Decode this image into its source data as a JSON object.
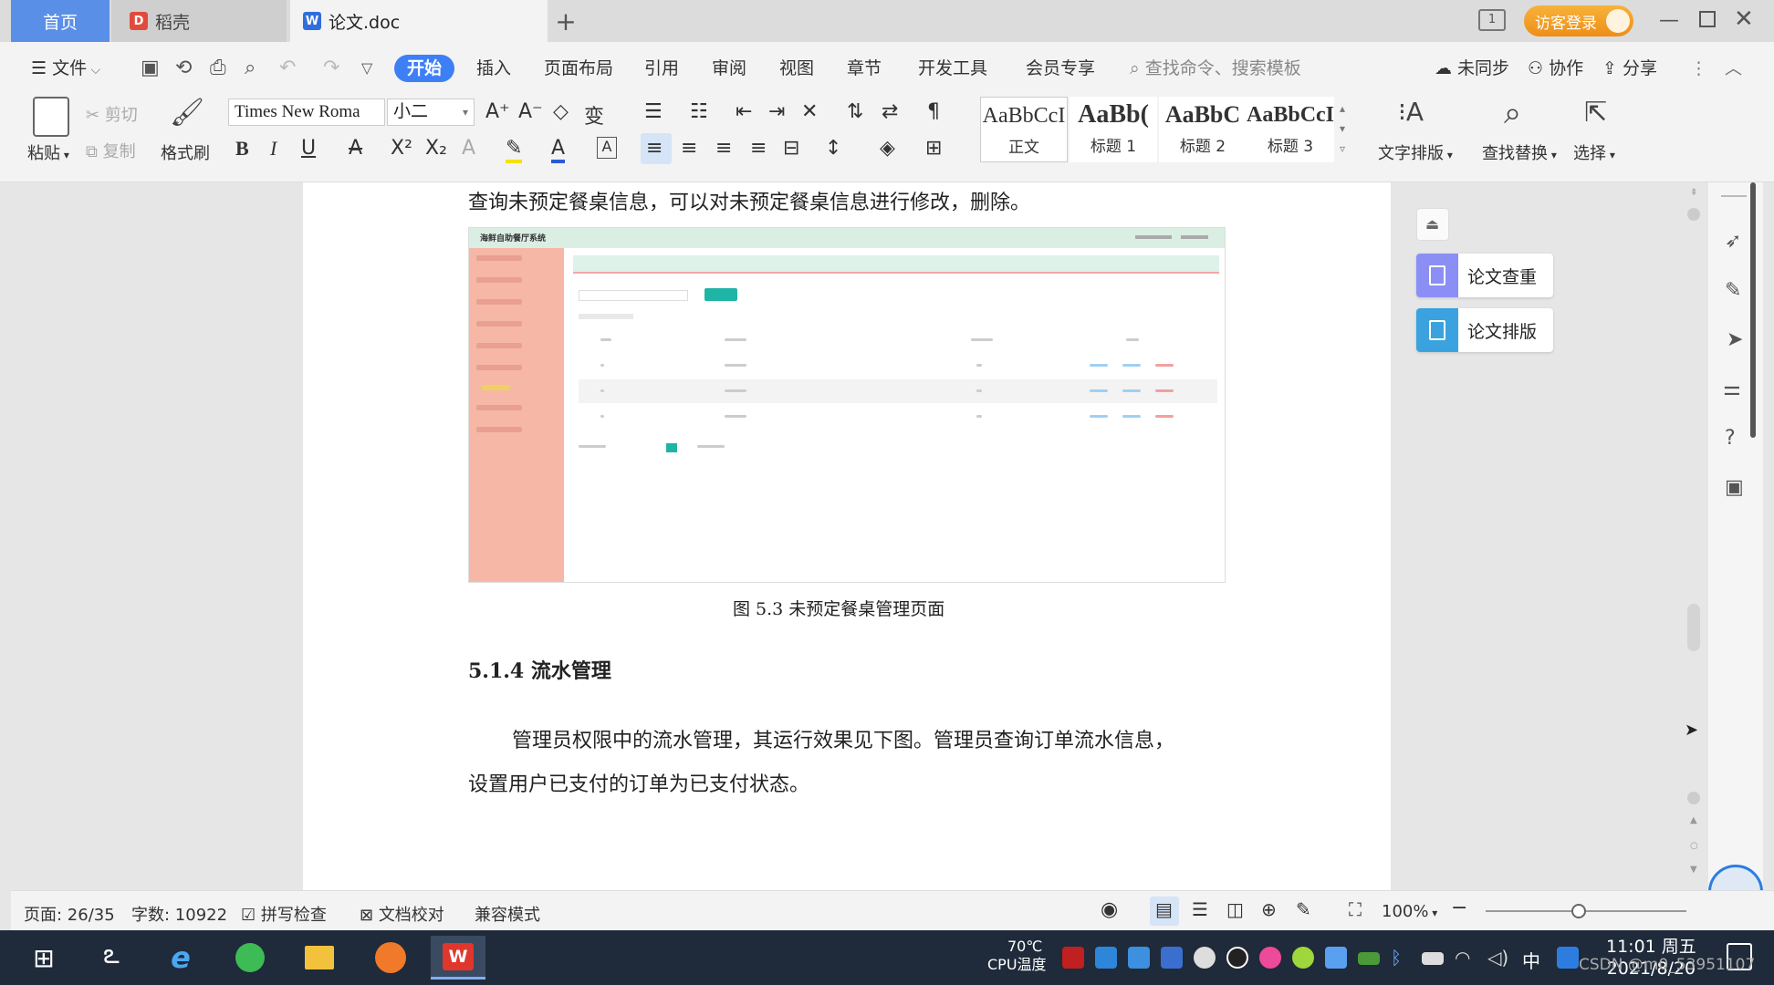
{
  "tabs": {
    "home": "首页",
    "daoke": "稻壳",
    "doc": "论文.doc"
  },
  "login": "访客登录",
  "menu": {
    "file": "文件",
    "start": "开始",
    "insert": "插入",
    "layout": "页面布局",
    "ref": "引用",
    "review": "审阅",
    "view": "视图",
    "chapter": "章节",
    "devtools": "开发工具",
    "vip": "会员专享",
    "search": "查找命令、搜索模板",
    "sync": "未同步",
    "collab": "协作",
    "share": "分享"
  },
  "ribbon": {
    "paste": "粘贴",
    "cut": "剪切",
    "copy": "复制",
    "format_painter": "格式刷",
    "font_name": "Times New Roma",
    "font_size": "小二",
    "styles": [
      {
        "sample": "AaBbCcI",
        "name": "正文"
      },
      {
        "sample": "AaBb(",
        "name": "标题 1"
      },
      {
        "sample": "AaBbC",
        "name": "标题 2"
      },
      {
        "sample": "AaBbCcI",
        "name": "标题 3"
      }
    ],
    "text_layout": "文字排版",
    "find_replace": "查找替换",
    "select": "选择"
  },
  "document": {
    "line1": "查询未预定餐桌信息，可以对未预定餐桌信息进行修改，删除。",
    "embedded_title": "海鲜自助餐厅系统",
    "caption": "图 5.3  未预定餐桌管理页面",
    "heading": "5.1.4  流水管理",
    "para1": "管理员权限中的流水管理，其运行效果见下图。管理员查询订单流水信息，",
    "para2": "设置用户已支付的订单为已支付状态。"
  },
  "panel": {
    "check": "论文查重",
    "layout": "论文排版"
  },
  "status": {
    "page": "页面: 26/35",
    "words": "字数: 10922",
    "spell": "拼写检查",
    "proof": "文档校对",
    "compat": "兼容模式",
    "zoom": "100%"
  },
  "taskbar": {
    "cpu_temp": "70℃",
    "cpu_label": "CPU温度",
    "ime": "中",
    "time": "11:01 周五",
    "date": "2021/8/20",
    "watermark": "CSDN @m0_53951107"
  },
  "colors": {
    "accent": "#3d7ff5",
    "login": "#f29b22",
    "sidebar": "#f6b7a6"
  }
}
